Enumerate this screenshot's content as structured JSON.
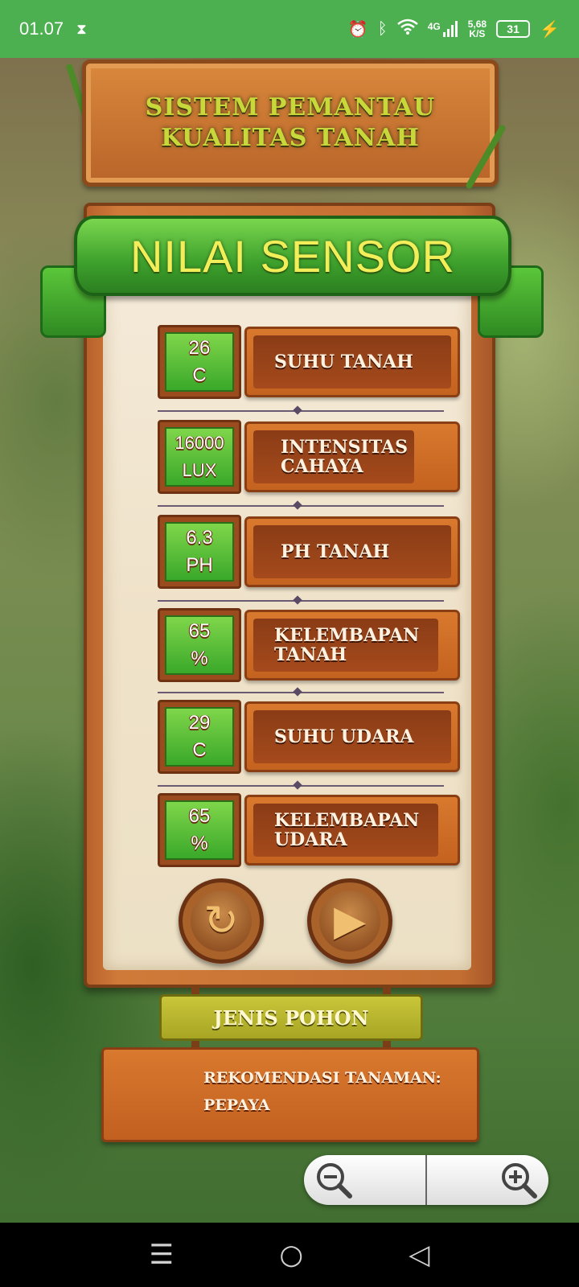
{
  "status_bar": {
    "time": "01.07",
    "net_type": "4G",
    "speed_value": "5,68",
    "speed_unit": "K/S",
    "battery": "31"
  },
  "header": {
    "title": "Sistem Pemantau Kualitas Tanah"
  },
  "panel": {
    "title": "NILAI SENSOR"
  },
  "sensors": [
    {
      "value": "26",
      "unit": "C",
      "label": "suhu Tanah"
    },
    {
      "value": "16000",
      "unit": "LUX",
      "label": "intensitas cahaya"
    },
    {
      "value": "6.3",
      "unit": "PH",
      "label": "PH Tanah"
    },
    {
      "value": "65",
      "unit": "%",
      "label": "Kelembapan tanah"
    },
    {
      "value": "29",
      "unit": "C",
      "label": "suhu Udara"
    },
    {
      "value": "65",
      "unit": "%",
      "label": "Kelembapan Udara"
    }
  ],
  "buttons": {
    "refresh_icon": "refresh-icon",
    "play_icon": "play-icon"
  },
  "tree_type": {
    "label": "Jenis Pohon"
  },
  "recommendation": {
    "label": "Rekomendasi Tanaman:",
    "value": "pepaya"
  },
  "zoom": {
    "out_icon": "zoom-out-icon",
    "in_icon": "zoom-in-icon"
  },
  "colors": {
    "status_bar": "#4caf50",
    "value_green": "#3aa82a",
    "wood": "#c4621f",
    "ribbon_text": "#f1ee5a"
  }
}
